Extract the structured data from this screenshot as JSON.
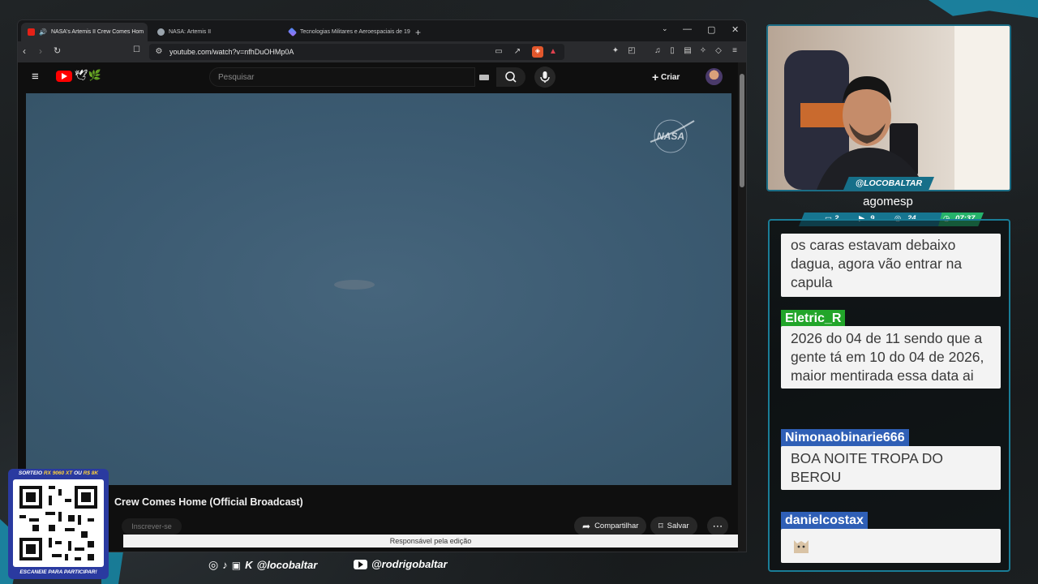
{
  "browser": {
    "tabs": [
      {
        "label": "NASA's Artemis II Crew Comes Hom",
        "active": true
      },
      {
        "label": "NASA: Artemis II",
        "active": false
      },
      {
        "label": "Tecnologias Militares e Aeroespaciais de 19",
        "active": false
      }
    ],
    "new_tab": "+",
    "url": "youtube.com/watch?v=nfhDuOHMp0A",
    "window_controls": {
      "minimize": "—",
      "maximize": "▢",
      "close": "✕"
    }
  },
  "youtube": {
    "search_placeholder": "Pesquisar",
    "create_label": "Criar",
    "video_title": "Crew Comes Home (Official Broadcast)",
    "subscribe_label": "Inscrever-se",
    "share_label": "Compartilhar",
    "save_label": "Salvar",
    "editor_note": "Responsável pela edição",
    "watermark": "NASA"
  },
  "stream": {
    "channel_tag": "@LOCOBALTAR",
    "viewer_name": "agomesp",
    "stats": {
      "chat": "2",
      "youtube": "9",
      "viewers": "24",
      "time": "07:37"
    }
  },
  "chat": {
    "messages": [
      {
        "user": "",
        "text": "os caras estavam debaixo dagua, agora vão entrar na capula",
        "color": "#f3f3f3"
      },
      {
        "user": "Eletric_R",
        "text": "2026 do 04 de 11 sendo que a gente tá em 10 do 04 de 2026, maior mentirada essa data ai",
        "color": "#22a52a"
      },
      {
        "user": "Nimonaobinarie666",
        "text": "BOA NOITE TROPA DO BEROU",
        "color": "#2f5fb6"
      },
      {
        "user": "danielcostax",
        "text": "",
        "color": "#2f5fb6"
      }
    ]
  },
  "promo": {
    "top_prefix": "SORTEIO",
    "top_item": "RX 9060 XT",
    "top_or": "OU",
    "top_amount": "R$ 8K",
    "bottom": "ESCANEIE PARA PARTICIPAR!"
  },
  "socials": {
    "handle_1": "@locobaltar",
    "handle_2": "@rodrigobaltar"
  },
  "colors": {
    "accent": "#1a8fb0",
    "live_green": "#25b36a"
  }
}
